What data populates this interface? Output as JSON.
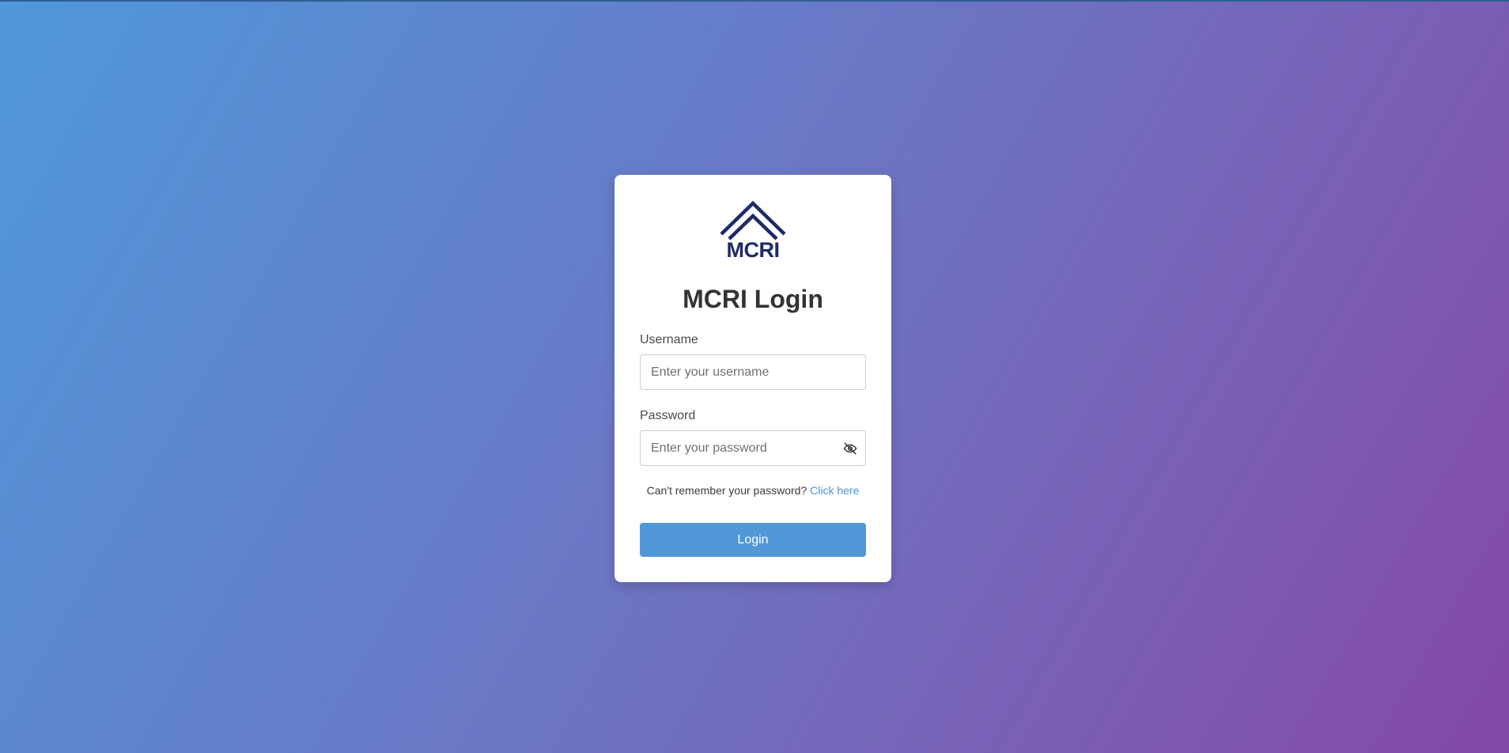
{
  "brand": {
    "logo_text": "MCRI",
    "logo_color": "#1f2a68"
  },
  "login": {
    "title": "MCRI Login",
    "username_label": "Username",
    "username_placeholder": "Enter your username",
    "password_label": "Password",
    "password_placeholder": "Enter your password",
    "password_toggle_icon": "eye-off-icon",
    "forgot_text": "Can't remember your password?",
    "forgot_link": "Click here",
    "submit_label": "Login"
  },
  "colors": {
    "background_start": "#4f98d9",
    "background_end": "#8448a7",
    "button": "#5297d8",
    "link": "#4f8fd6"
  }
}
